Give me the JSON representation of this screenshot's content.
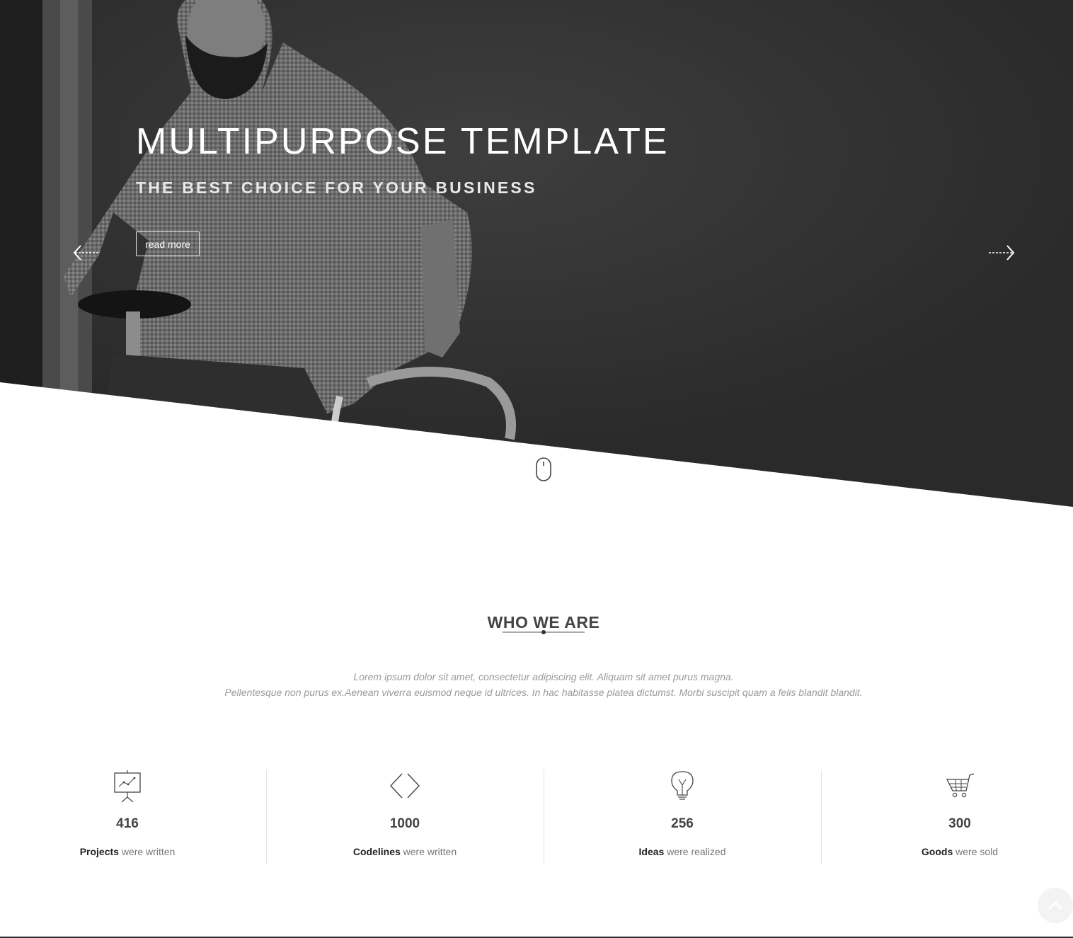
{
  "hero": {
    "title": "MULTIPURPOSE TEMPLATE",
    "subtitle": "THE BEST CHOICE FOR YOUR BUSINESS",
    "button_label": "read more",
    "prev_icon": "arrow-left-icon",
    "next_icon": "arrow-right-icon",
    "scroll_icon": "mouse-icon"
  },
  "about": {
    "title": "WHO WE ARE",
    "line1": "Lorem ipsum dolor sit amet, consectetur adipiscing elit. Aliquam sit amet purus magna.",
    "line2": "Pellentesque non purus ex.Aenean viverra euismod neque id ultrices. In hac habitasse platea dictumst. Morbi suscipit quam a felis blandit blandit."
  },
  "stats": [
    {
      "icon": "presentation-chart-icon",
      "number": "416",
      "strong": "Projects",
      "rest": " were written"
    },
    {
      "icon": "code-brackets-icon",
      "number": "1000",
      "strong": "Codelines",
      "rest": " were written"
    },
    {
      "icon": "lightbulb-icon",
      "number": "256",
      "strong": "Ideas",
      "rest": " were realized"
    },
    {
      "icon": "shopping-cart-icon",
      "number": "300",
      "strong": "Goods",
      "rest": " were sold"
    }
  ],
  "colors": {
    "hero_dark": "#2f2f2f",
    "accent_text": "#444444",
    "muted_text": "#9a9a9a"
  }
}
